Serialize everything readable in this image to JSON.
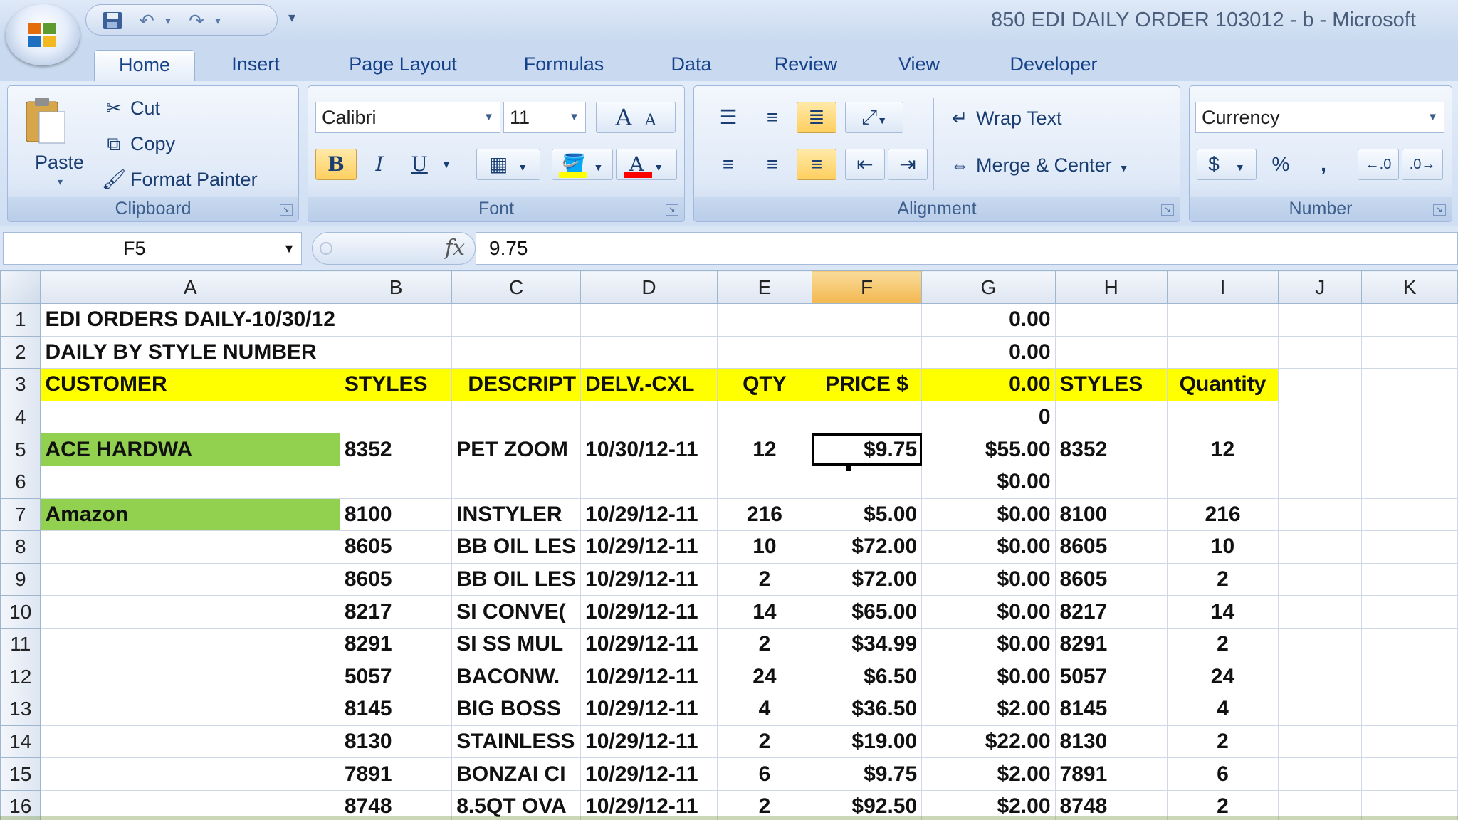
{
  "window": {
    "title": "850 EDI DAILY ORDER 103012 - b - Microsoft"
  },
  "tabs": [
    "Home",
    "Insert",
    "Page Layout",
    "Formulas",
    "Data",
    "Review",
    "View",
    "Developer"
  ],
  "ribbon": {
    "clipboard": {
      "label": "Clipboard",
      "paste": "Paste",
      "cut": "Cut",
      "copy": "Copy",
      "format_painter": "Format Painter"
    },
    "font": {
      "label": "Font",
      "font_name": "Calibri",
      "font_size": "11",
      "bold": "B",
      "italic": "I",
      "underline": "U",
      "grow": "A",
      "shrink": "A",
      "font_color_letter": "A",
      "fill_color": "#ffff00",
      "font_color": "#ff0000"
    },
    "alignment": {
      "label": "Alignment",
      "wrap_text": "Wrap Text",
      "merge_center": "Merge & Center"
    },
    "number": {
      "label": "Number",
      "format": "Currency",
      "currency": "$",
      "percent": "%",
      "comma": ","
    }
  },
  "formula_bar": {
    "name_box": "F5",
    "fx": "fx",
    "value": "9.75"
  },
  "grid": {
    "columns": [
      "A",
      "B",
      "C",
      "D",
      "E",
      "F",
      "G",
      "H",
      "I",
      "J",
      "K"
    ],
    "selected_column": "F",
    "rows": [
      {
        "n": "1",
        "cells": [
          "EDI ORDERS DAILY-10/30/12",
          "",
          "",
          "",
          "",
          "",
          "0.00",
          "",
          "",
          "",
          ""
        ]
      },
      {
        "n": "2",
        "cells": [
          "DAILY BY STYLE NUMBER",
          "",
          "",
          "",
          "",
          "",
          "0.00",
          "",
          "",
          "",
          ""
        ]
      },
      {
        "n": "3",
        "cells": [
          "CUSTOMER",
          "STYLES",
          "DESCRIPT",
          "DELV.-CXL",
          "QTY",
          "PRICE $",
          "0.00",
          "STYLES",
          "Quantity",
          "",
          ""
        ]
      },
      {
        "n": "4",
        "cells": [
          "",
          "",
          "",
          "",
          "",
          "",
          "0",
          "",
          "",
          "",
          ""
        ]
      },
      {
        "n": "5",
        "cells": [
          "ACE HARDWA",
          "8352",
          "PET ZOOM",
          "10/30/12-11",
          "12",
          "$9.75",
          "$55.00",
          "8352",
          "12",
          "",
          ""
        ]
      },
      {
        "n": "6",
        "cells": [
          "",
          "",
          "",
          "",
          "",
          "",
          "$0.00",
          "",
          "",
          "",
          ""
        ]
      },
      {
        "n": "7",
        "cells": [
          "Amazon",
          "8100",
          "INSTYLER",
          "10/29/12-11",
          "216",
          "$5.00",
          "$0.00",
          "8100",
          "216",
          "",
          ""
        ]
      },
      {
        "n": "8",
        "cells": [
          "",
          "8605",
          "BB OIL LES",
          "10/29/12-11",
          "10",
          "$72.00",
          "$0.00",
          "8605",
          "10",
          "",
          ""
        ]
      },
      {
        "n": "9",
        "cells": [
          "",
          "8605",
          "BB OIL LES",
          "10/29/12-11",
          "2",
          "$72.00",
          "$0.00",
          "8605",
          "2",
          "",
          ""
        ]
      },
      {
        "n": "10",
        "cells": [
          "",
          "8217",
          "SI CONVE(",
          "10/29/12-11",
          "14",
          "$65.00",
          "$0.00",
          "8217",
          "14",
          "",
          ""
        ]
      },
      {
        "n": "11",
        "cells": [
          "",
          "8291",
          "SI SS MUL",
          "10/29/12-11",
          "2",
          "$34.99",
          "$0.00",
          "8291",
          "2",
          "",
          ""
        ]
      },
      {
        "n": "12",
        "cells": [
          "",
          "5057",
          "BACONW.",
          "10/29/12-11",
          "24",
          "$6.50",
          "$0.00",
          "5057",
          "24",
          "",
          ""
        ]
      },
      {
        "n": "13",
        "cells": [
          "",
          "8145",
          "BIG BOSS",
          "10/29/12-11",
          "4",
          "$36.50",
          "$2.00",
          "8145",
          "4",
          "",
          ""
        ]
      },
      {
        "n": "14",
        "cells": [
          "",
          "8130",
          "STAINLESS",
          "10/29/12-11",
          "2",
          "$19.00",
          "$22.00",
          "8130",
          "2",
          "",
          ""
        ]
      },
      {
        "n": "15",
        "cells": [
          "",
          "7891",
          "BONZAI CI",
          "10/29/12-11",
          "6",
          "$9.75",
          "$2.00",
          "7891",
          "6",
          "",
          ""
        ]
      },
      {
        "n": "16",
        "cells": [
          "",
          "8748",
          "8.5QT OVA",
          "10/29/12-11",
          "2",
          "$92.50",
          "$2.00",
          "8748",
          "2",
          "",
          ""
        ]
      }
    ]
  }
}
